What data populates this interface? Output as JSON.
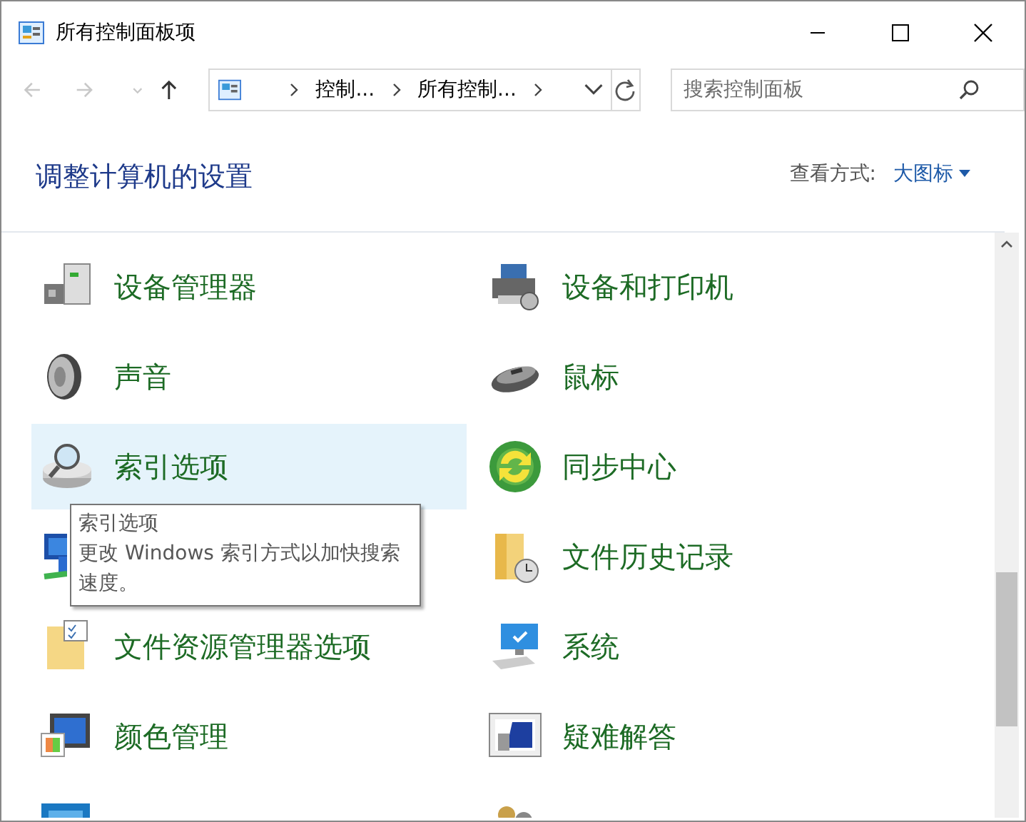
{
  "window": {
    "title": "所有控制面板项"
  },
  "nav": [
    {
      "kind": "back",
      "disabled": true
    },
    {
      "kind": "forward",
      "disabled": true
    },
    {
      "kind": "history",
      "disabled": true
    },
    {
      "kind": "up",
      "disabled": false
    }
  ],
  "address": {
    "crumbs": [
      "控制...",
      "所有控制..."
    ]
  },
  "search": {
    "placeholder": "搜索控制面板"
  },
  "header": {
    "title": "调整计算机的设置",
    "view_label": "查看方式:",
    "view_value": "大图标"
  },
  "items": [
    {
      "kind": "device",
      "label": "设备管理器",
      "hovered": false
    },
    {
      "kind": "printer",
      "label": "设备和打印机",
      "hovered": false
    },
    {
      "kind": "speaker",
      "label": "声音",
      "hovered": false
    },
    {
      "kind": "mouse",
      "label": "鼠标",
      "hovered": false
    },
    {
      "kind": "index",
      "label": "索引选项",
      "hovered": true
    },
    {
      "kind": "sync",
      "label": "同步中心",
      "hovered": false
    },
    {
      "kind": "network",
      "hovered": false
    },
    {
      "kind": "history",
      "label": "文件历史记录",
      "hovered": false
    },
    {
      "kind": "folder",
      "label": "文件资源管理器选项",
      "hovered": false
    },
    {
      "kind": "system",
      "label": "系统",
      "hovered": false
    },
    {
      "kind": "color",
      "label": "颜色管理",
      "hovered": false
    },
    {
      "kind": "trouble",
      "label": "疑难解答",
      "hovered": false
    },
    {
      "kind": "display",
      "hovered": false
    },
    {
      "kind": "users",
      "hovered": false
    }
  ],
  "tooltip": {
    "title": "索引选项",
    "text": "更改 Windows 索引方式以加快搜索速度。"
  }
}
